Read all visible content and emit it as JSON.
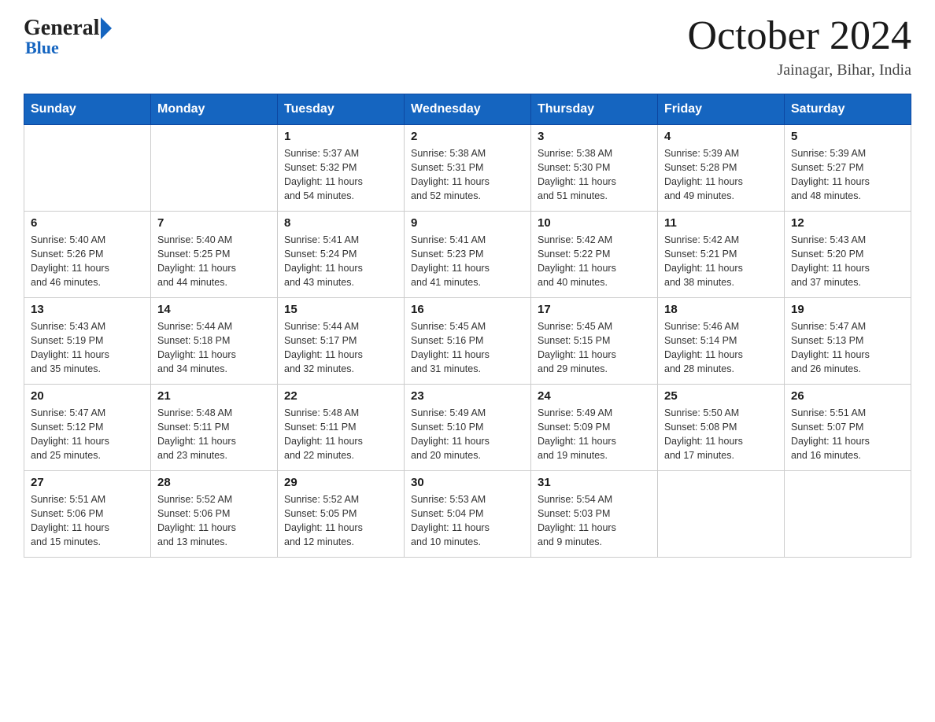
{
  "header": {
    "title": "October 2024",
    "location": "Jainagar, Bihar, India",
    "logo_general": "General",
    "logo_blue": "Blue"
  },
  "days_of_week": [
    "Sunday",
    "Monday",
    "Tuesday",
    "Wednesday",
    "Thursday",
    "Friday",
    "Saturday"
  ],
  "weeks": [
    [
      {
        "day": "",
        "info": ""
      },
      {
        "day": "",
        "info": ""
      },
      {
        "day": "1",
        "info": "Sunrise: 5:37 AM\nSunset: 5:32 PM\nDaylight: 11 hours\nand 54 minutes."
      },
      {
        "day": "2",
        "info": "Sunrise: 5:38 AM\nSunset: 5:31 PM\nDaylight: 11 hours\nand 52 minutes."
      },
      {
        "day": "3",
        "info": "Sunrise: 5:38 AM\nSunset: 5:30 PM\nDaylight: 11 hours\nand 51 minutes."
      },
      {
        "day": "4",
        "info": "Sunrise: 5:39 AM\nSunset: 5:28 PM\nDaylight: 11 hours\nand 49 minutes."
      },
      {
        "day": "5",
        "info": "Sunrise: 5:39 AM\nSunset: 5:27 PM\nDaylight: 11 hours\nand 48 minutes."
      }
    ],
    [
      {
        "day": "6",
        "info": "Sunrise: 5:40 AM\nSunset: 5:26 PM\nDaylight: 11 hours\nand 46 minutes."
      },
      {
        "day": "7",
        "info": "Sunrise: 5:40 AM\nSunset: 5:25 PM\nDaylight: 11 hours\nand 44 minutes."
      },
      {
        "day": "8",
        "info": "Sunrise: 5:41 AM\nSunset: 5:24 PM\nDaylight: 11 hours\nand 43 minutes."
      },
      {
        "day": "9",
        "info": "Sunrise: 5:41 AM\nSunset: 5:23 PM\nDaylight: 11 hours\nand 41 minutes."
      },
      {
        "day": "10",
        "info": "Sunrise: 5:42 AM\nSunset: 5:22 PM\nDaylight: 11 hours\nand 40 minutes."
      },
      {
        "day": "11",
        "info": "Sunrise: 5:42 AM\nSunset: 5:21 PM\nDaylight: 11 hours\nand 38 minutes."
      },
      {
        "day": "12",
        "info": "Sunrise: 5:43 AM\nSunset: 5:20 PM\nDaylight: 11 hours\nand 37 minutes."
      }
    ],
    [
      {
        "day": "13",
        "info": "Sunrise: 5:43 AM\nSunset: 5:19 PM\nDaylight: 11 hours\nand 35 minutes."
      },
      {
        "day": "14",
        "info": "Sunrise: 5:44 AM\nSunset: 5:18 PM\nDaylight: 11 hours\nand 34 minutes."
      },
      {
        "day": "15",
        "info": "Sunrise: 5:44 AM\nSunset: 5:17 PM\nDaylight: 11 hours\nand 32 minutes."
      },
      {
        "day": "16",
        "info": "Sunrise: 5:45 AM\nSunset: 5:16 PM\nDaylight: 11 hours\nand 31 minutes."
      },
      {
        "day": "17",
        "info": "Sunrise: 5:45 AM\nSunset: 5:15 PM\nDaylight: 11 hours\nand 29 minutes."
      },
      {
        "day": "18",
        "info": "Sunrise: 5:46 AM\nSunset: 5:14 PM\nDaylight: 11 hours\nand 28 minutes."
      },
      {
        "day": "19",
        "info": "Sunrise: 5:47 AM\nSunset: 5:13 PM\nDaylight: 11 hours\nand 26 minutes."
      }
    ],
    [
      {
        "day": "20",
        "info": "Sunrise: 5:47 AM\nSunset: 5:12 PM\nDaylight: 11 hours\nand 25 minutes."
      },
      {
        "day": "21",
        "info": "Sunrise: 5:48 AM\nSunset: 5:11 PM\nDaylight: 11 hours\nand 23 minutes."
      },
      {
        "day": "22",
        "info": "Sunrise: 5:48 AM\nSunset: 5:11 PM\nDaylight: 11 hours\nand 22 minutes."
      },
      {
        "day": "23",
        "info": "Sunrise: 5:49 AM\nSunset: 5:10 PM\nDaylight: 11 hours\nand 20 minutes."
      },
      {
        "day": "24",
        "info": "Sunrise: 5:49 AM\nSunset: 5:09 PM\nDaylight: 11 hours\nand 19 minutes."
      },
      {
        "day": "25",
        "info": "Sunrise: 5:50 AM\nSunset: 5:08 PM\nDaylight: 11 hours\nand 17 minutes."
      },
      {
        "day": "26",
        "info": "Sunrise: 5:51 AM\nSunset: 5:07 PM\nDaylight: 11 hours\nand 16 minutes."
      }
    ],
    [
      {
        "day": "27",
        "info": "Sunrise: 5:51 AM\nSunset: 5:06 PM\nDaylight: 11 hours\nand 15 minutes."
      },
      {
        "day": "28",
        "info": "Sunrise: 5:52 AM\nSunset: 5:06 PM\nDaylight: 11 hours\nand 13 minutes."
      },
      {
        "day": "29",
        "info": "Sunrise: 5:52 AM\nSunset: 5:05 PM\nDaylight: 11 hours\nand 12 minutes."
      },
      {
        "day": "30",
        "info": "Sunrise: 5:53 AM\nSunset: 5:04 PM\nDaylight: 11 hours\nand 10 minutes."
      },
      {
        "day": "31",
        "info": "Sunrise: 5:54 AM\nSunset: 5:03 PM\nDaylight: 11 hours\nand 9 minutes."
      },
      {
        "day": "",
        "info": ""
      },
      {
        "day": "",
        "info": ""
      }
    ]
  ]
}
